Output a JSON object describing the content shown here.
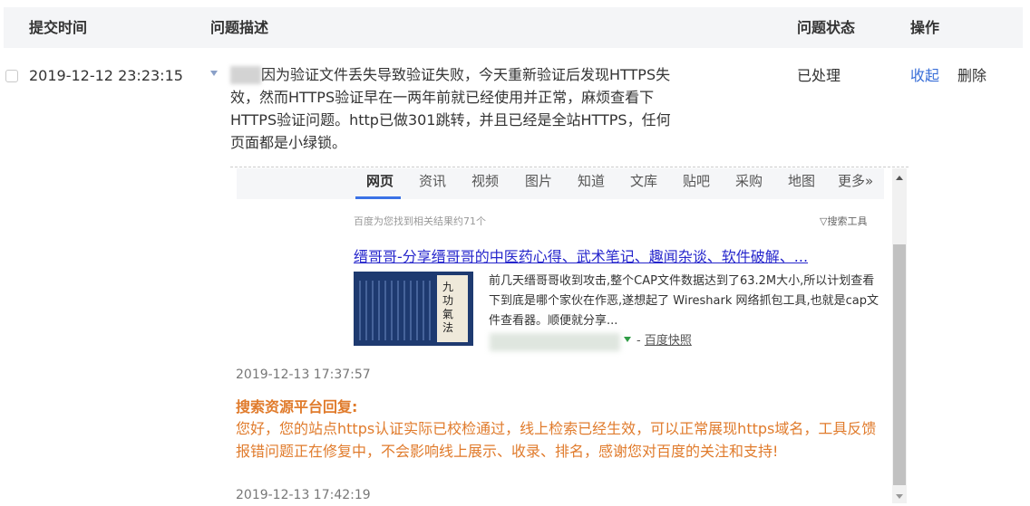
{
  "headers": {
    "time": "提交时间",
    "desc": "问题描述",
    "status": "问题状态",
    "actions": "操作"
  },
  "row": {
    "submitted": "2019-12-12 23:23:15",
    "description": "因为验证文件丢失导致验证失败，今天重新验证后发现HTTPS失效，然而HTTPS验证早在一两年前就已经使用并正常，麻烦查看下HTTPS验证问题。http已做301跳转，并且已经是全站HTTPS，任何页面都是小绿锁。",
    "status": "已处理",
    "collapse_label": "收起",
    "delete_label": "删除"
  },
  "attachment": {
    "tabs": [
      "网页",
      "资讯",
      "视频",
      "图片",
      "知道",
      "文库",
      "贴吧",
      "采购",
      "地图",
      "更多»"
    ],
    "found_text": "百度为您找到相关结果约71个",
    "tool_text": "▽搜索工具",
    "result_title": "缙哥哥-分享缙哥哥的中医药心得、武术笔记、趣闻杂谈、软件破解、...",
    "thumb_text": "九功\n氣法",
    "snippet": "前几天缙哥哥收到攻击,整个CAP文件数据达到了63.2M大小,所以计划查看下到底是哪个家伙在作恶,遂想起了 Wireshark 网络抓包工具,也就是cap文件查看器。顺便就分享...",
    "cache_prefix": "- ",
    "cache_label": "百度快照"
  },
  "thread": {
    "timestamp1": "2019-12-13 17:37:57",
    "reply_heading": "搜索资源平台回复:",
    "reply_text": "您好，您的站点https认证实际已校检通过，线上检索已经生效，可以正常展现https域名，工具反馈报错问题正在修复中，不会影响线上展示、收录、排名，感谢您对百度的关注和支持!",
    "timestamp2": "2019-12-13 17:42:19"
  },
  "colors": {
    "link": "#3a6fd8",
    "reply": "#e07b2c",
    "result_title": "#2626cc",
    "tab_active": "#3b72e6"
  }
}
